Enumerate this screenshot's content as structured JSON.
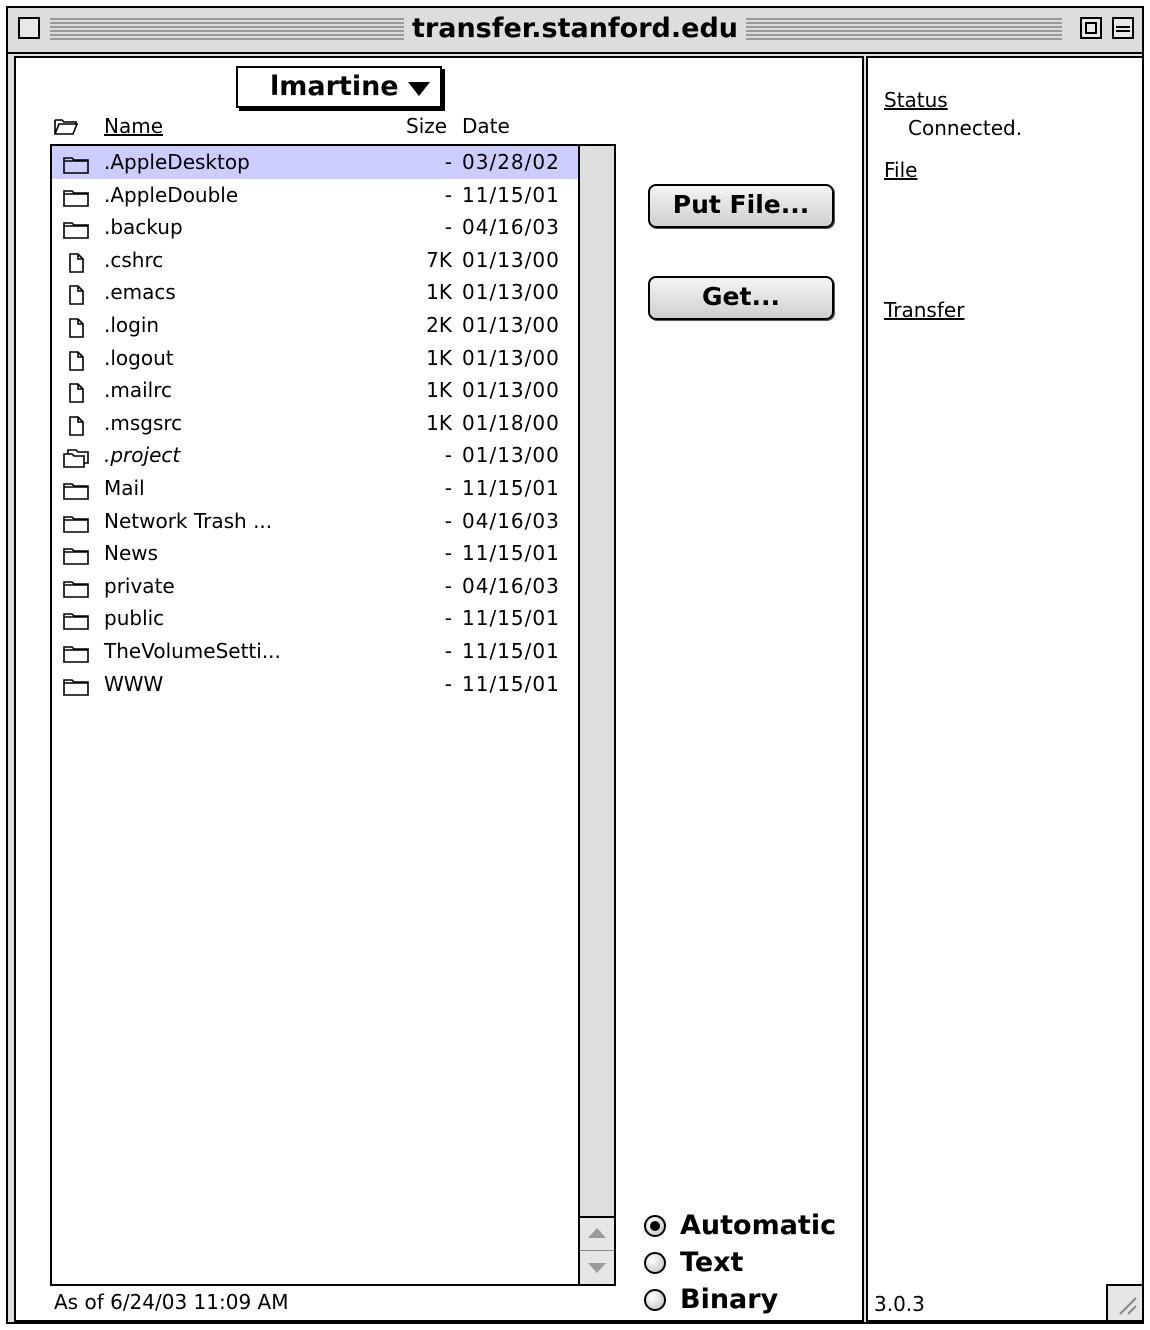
{
  "window": {
    "title": "transfer.stanford.edu"
  },
  "folder_popup": {
    "label": "lmartine"
  },
  "list_header": {
    "name": "Name",
    "size": "Size",
    "date": "Date"
  },
  "files": [
    {
      "name": ".AppleDesktop",
      "size": "-",
      "date": "03/28/02",
      "icon": "folder-icon",
      "selected": true
    },
    {
      "name": ".AppleDouble",
      "size": "-",
      "date": "11/15/01",
      "icon": "folder-icon"
    },
    {
      "name": ".backup",
      "size": "-",
      "date": "04/16/03",
      "icon": "folder-icon"
    },
    {
      "name": ".cshrc",
      "size": "7K",
      "date": "01/13/00",
      "icon": "document-icon"
    },
    {
      "name": ".emacs",
      "size": "1K",
      "date": "01/13/00",
      "icon": "document-icon"
    },
    {
      "name": ".login",
      "size": "2K",
      "date": "01/13/00",
      "icon": "document-icon"
    },
    {
      "name": ".logout",
      "size": "1K",
      "date": "01/13/00",
      "icon": "document-icon"
    },
    {
      "name": ".mailrc",
      "size": "1K",
      "date": "01/13/00",
      "icon": "document-icon"
    },
    {
      "name": ".msgsrc",
      "size": "1K",
      "date": "01/18/00",
      "icon": "document-icon"
    },
    {
      "name": ".project",
      "size": "-",
      "date": "01/13/00",
      "icon": "alias-folder-icon",
      "italic": true
    },
    {
      "name": "Mail",
      "size": "-",
      "date": "11/15/01",
      "icon": "folder-icon"
    },
    {
      "name": "Network Trash ...",
      "size": "-",
      "date": "04/16/03",
      "icon": "folder-icon"
    },
    {
      "name": "News",
      "size": "-",
      "date": "11/15/01",
      "icon": "folder-icon"
    },
    {
      "name": "private",
      "size": "-",
      "date": "04/16/03",
      "icon": "folder-icon"
    },
    {
      "name": "public",
      "size": "-",
      "date": "11/15/01",
      "icon": "folder-icon"
    },
    {
      "name": "TheVolumeSetti...",
      "size": "-",
      "date": "11/15/01",
      "icon": "folder-icon"
    },
    {
      "name": "WWW",
      "size": "-",
      "date": "11/15/01",
      "icon": "folder-icon"
    }
  ],
  "list_status": "As of 6/24/03 11:09 AM",
  "buttons": {
    "put_file": "Put File...",
    "get": "Get..."
  },
  "transfer_mode": {
    "options": [
      "Automatic",
      "Text",
      "Binary"
    ],
    "selected": "Automatic"
  },
  "info_panel": {
    "status_label": "Status",
    "status_value": "Connected.",
    "file_label": "File",
    "transfer_label": "Transfer",
    "version": "3.0.3"
  },
  "colors": {
    "selection": "#ccccff",
    "chrome": "#dddddd"
  }
}
